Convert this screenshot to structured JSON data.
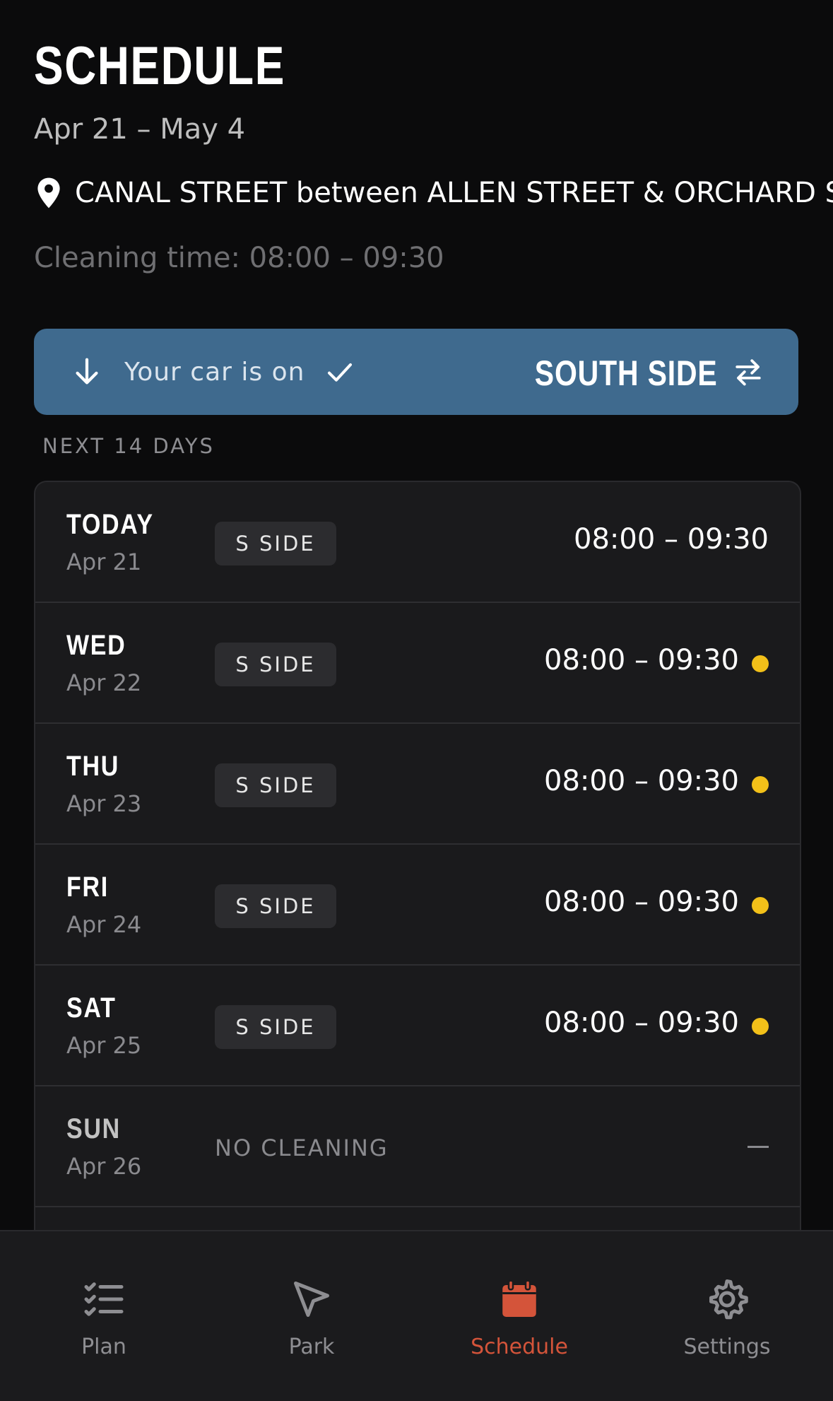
{
  "header": {
    "title": "SCHEDULE",
    "date_range": "Apr 21 – May 4",
    "location": "CANAL STREET between ALLEN STREET & ORCHARD S",
    "cleaning_time": "Cleaning time: 08:00 – 09:30"
  },
  "car_bar": {
    "label": "Your car is on",
    "side": "SOUTH SIDE",
    "icons": [
      "arrow-down-icon",
      "check-icon",
      "swap-icon"
    ],
    "color": "#3f6a8e"
  },
  "section_label": "NEXT 14 DAYS",
  "days": [
    {
      "day": "TODAY",
      "date": "Apr 21",
      "side": "S SIDE",
      "time": "08:00 – 09:30",
      "dot": false
    },
    {
      "day": "WED",
      "date": "Apr 22",
      "side": "S SIDE",
      "time": "08:00 – 09:30",
      "dot": true
    },
    {
      "day": "THU",
      "date": "Apr 23",
      "side": "S SIDE",
      "time": "08:00 – 09:30",
      "dot": true
    },
    {
      "day": "FRI",
      "date": "Apr 24",
      "side": "S SIDE",
      "time": "08:00 – 09:30",
      "dot": true
    },
    {
      "day": "SAT",
      "date": "Apr 25",
      "side": "S SIDE",
      "time": "08:00 – 09:30",
      "dot": true
    },
    {
      "day": "SUN",
      "date": "Apr 26",
      "none_label": "NO CLEANING"
    }
  ],
  "colors": {
    "dot": "#f2c019",
    "active_tab": "#d4543a",
    "background": "#0b0b0c"
  },
  "tabs": [
    {
      "label": "Plan",
      "icon": "checklist-icon",
      "active": false
    },
    {
      "label": "Park",
      "icon": "navigation-arrow-icon",
      "active": false
    },
    {
      "label": "Schedule",
      "icon": "calendar-icon",
      "active": true
    },
    {
      "label": "Settings",
      "icon": "gear-icon",
      "active": false
    }
  ]
}
